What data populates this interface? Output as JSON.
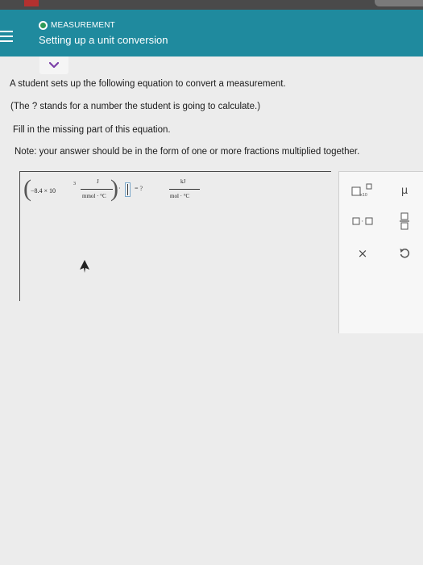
{
  "header": {
    "topic": "MEASUREMENT",
    "title": "Setting up a unit conversion"
  },
  "prompt": {
    "line1": "A student sets up the following equation to convert a measurement.",
    "line2": "(The ? stands for a number the student is going to calculate.)",
    "line3": "Fill in the missing part of this equation.",
    "line4": "Note: your answer should be in the form of one or more fractions multiplied together."
  },
  "equation": {
    "coefficient": "−8.4 × 10",
    "exponent": "3",
    "unit1_numerator": "J",
    "unit1_denominator": "mmol · °C",
    "dot": "·",
    "equals_unknown": "= ?",
    "unit2_numerator": "kJ",
    "unit2_denominator": "mol · °C"
  },
  "palette": {
    "sci_notation_label": "x10",
    "micro_symbol": "μ",
    "clear_symbol": "×",
    "dot_symbol": "·"
  },
  "colors": {
    "header": "#1f8a9e",
    "topic_dot": "#2e9b58",
    "chevron": "#7b3fa8"
  }
}
